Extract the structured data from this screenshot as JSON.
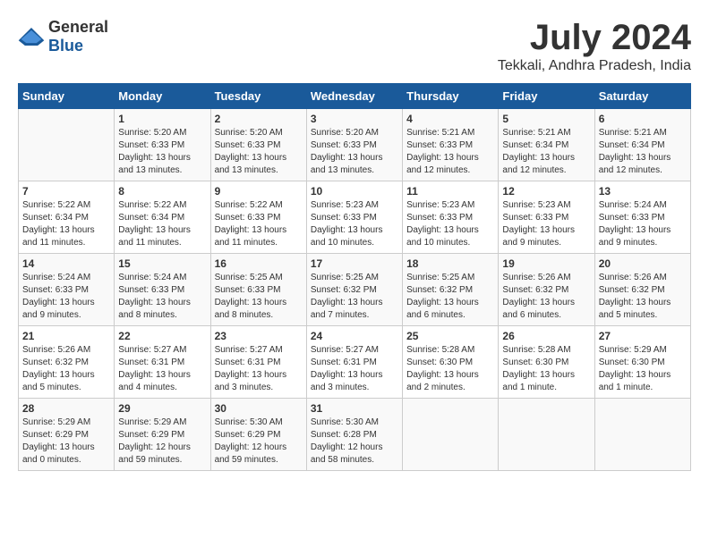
{
  "logo": {
    "text_general": "General",
    "text_blue": "Blue"
  },
  "title": "July 2024",
  "subtitle": "Tekkali, Andhra Pradesh, India",
  "calendar": {
    "headers": [
      "Sunday",
      "Monday",
      "Tuesday",
      "Wednesday",
      "Thursday",
      "Friday",
      "Saturday"
    ],
    "weeks": [
      [
        {
          "day": "",
          "info": ""
        },
        {
          "day": "1",
          "info": "Sunrise: 5:20 AM\nSunset: 6:33 PM\nDaylight: 13 hours\nand 13 minutes."
        },
        {
          "day": "2",
          "info": "Sunrise: 5:20 AM\nSunset: 6:33 PM\nDaylight: 13 hours\nand 13 minutes."
        },
        {
          "day": "3",
          "info": "Sunrise: 5:20 AM\nSunset: 6:33 PM\nDaylight: 13 hours\nand 13 minutes."
        },
        {
          "day": "4",
          "info": "Sunrise: 5:21 AM\nSunset: 6:33 PM\nDaylight: 13 hours\nand 12 minutes."
        },
        {
          "day": "5",
          "info": "Sunrise: 5:21 AM\nSunset: 6:34 PM\nDaylight: 13 hours\nand 12 minutes."
        },
        {
          "day": "6",
          "info": "Sunrise: 5:21 AM\nSunset: 6:34 PM\nDaylight: 13 hours\nand 12 minutes."
        }
      ],
      [
        {
          "day": "7",
          "info": "Sunrise: 5:22 AM\nSunset: 6:34 PM\nDaylight: 13 hours\nand 11 minutes."
        },
        {
          "day": "8",
          "info": "Sunrise: 5:22 AM\nSunset: 6:34 PM\nDaylight: 13 hours\nand 11 minutes."
        },
        {
          "day": "9",
          "info": "Sunrise: 5:22 AM\nSunset: 6:33 PM\nDaylight: 13 hours\nand 11 minutes."
        },
        {
          "day": "10",
          "info": "Sunrise: 5:23 AM\nSunset: 6:33 PM\nDaylight: 13 hours\nand 10 minutes."
        },
        {
          "day": "11",
          "info": "Sunrise: 5:23 AM\nSunset: 6:33 PM\nDaylight: 13 hours\nand 10 minutes."
        },
        {
          "day": "12",
          "info": "Sunrise: 5:23 AM\nSunset: 6:33 PM\nDaylight: 13 hours\nand 9 minutes."
        },
        {
          "day": "13",
          "info": "Sunrise: 5:24 AM\nSunset: 6:33 PM\nDaylight: 13 hours\nand 9 minutes."
        }
      ],
      [
        {
          "day": "14",
          "info": "Sunrise: 5:24 AM\nSunset: 6:33 PM\nDaylight: 13 hours\nand 9 minutes."
        },
        {
          "day": "15",
          "info": "Sunrise: 5:24 AM\nSunset: 6:33 PM\nDaylight: 13 hours\nand 8 minutes."
        },
        {
          "day": "16",
          "info": "Sunrise: 5:25 AM\nSunset: 6:33 PM\nDaylight: 13 hours\nand 8 minutes."
        },
        {
          "day": "17",
          "info": "Sunrise: 5:25 AM\nSunset: 6:32 PM\nDaylight: 13 hours\nand 7 minutes."
        },
        {
          "day": "18",
          "info": "Sunrise: 5:25 AM\nSunset: 6:32 PM\nDaylight: 13 hours\nand 6 minutes."
        },
        {
          "day": "19",
          "info": "Sunrise: 5:26 AM\nSunset: 6:32 PM\nDaylight: 13 hours\nand 6 minutes."
        },
        {
          "day": "20",
          "info": "Sunrise: 5:26 AM\nSunset: 6:32 PM\nDaylight: 13 hours\nand 5 minutes."
        }
      ],
      [
        {
          "day": "21",
          "info": "Sunrise: 5:26 AM\nSunset: 6:32 PM\nDaylight: 13 hours\nand 5 minutes."
        },
        {
          "day": "22",
          "info": "Sunrise: 5:27 AM\nSunset: 6:31 PM\nDaylight: 13 hours\nand 4 minutes."
        },
        {
          "day": "23",
          "info": "Sunrise: 5:27 AM\nSunset: 6:31 PM\nDaylight: 13 hours\nand 3 minutes."
        },
        {
          "day": "24",
          "info": "Sunrise: 5:27 AM\nSunset: 6:31 PM\nDaylight: 13 hours\nand 3 minutes."
        },
        {
          "day": "25",
          "info": "Sunrise: 5:28 AM\nSunset: 6:30 PM\nDaylight: 13 hours\nand 2 minutes."
        },
        {
          "day": "26",
          "info": "Sunrise: 5:28 AM\nSunset: 6:30 PM\nDaylight: 13 hours\nand 1 minute."
        },
        {
          "day": "27",
          "info": "Sunrise: 5:29 AM\nSunset: 6:30 PM\nDaylight: 13 hours\nand 1 minute."
        }
      ],
      [
        {
          "day": "28",
          "info": "Sunrise: 5:29 AM\nSunset: 6:29 PM\nDaylight: 13 hours\nand 0 minutes."
        },
        {
          "day": "29",
          "info": "Sunrise: 5:29 AM\nSunset: 6:29 PM\nDaylight: 12 hours\nand 59 minutes."
        },
        {
          "day": "30",
          "info": "Sunrise: 5:30 AM\nSunset: 6:29 PM\nDaylight: 12 hours\nand 59 minutes."
        },
        {
          "day": "31",
          "info": "Sunrise: 5:30 AM\nSunset: 6:28 PM\nDaylight: 12 hours\nand 58 minutes."
        },
        {
          "day": "",
          "info": ""
        },
        {
          "day": "",
          "info": ""
        },
        {
          "day": "",
          "info": ""
        }
      ]
    ]
  }
}
